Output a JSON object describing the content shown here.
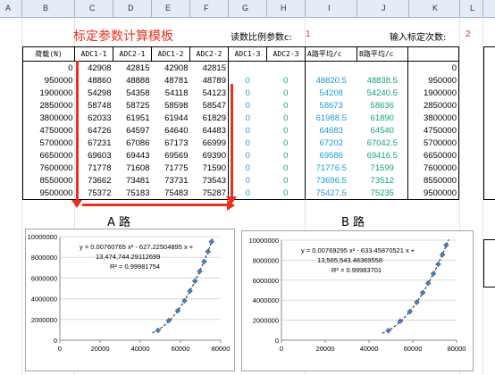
{
  "column_headers": [
    "A",
    "B",
    "C",
    "D",
    "E",
    "F",
    "G",
    "H",
    "I",
    "J",
    "K",
    "L"
  ],
  "title": "标定参数计算模板",
  "read_ratio_label": "读数比例参数c:",
  "read_ratio_value": "1",
  "input_count_label": "输入标定次数:",
  "input_count_value": "2",
  "table": {
    "headers": [
      "荷载(N)",
      "ADC1-1",
      "ADC2-1",
      "ADC1-2",
      "ADC2-2",
      "ADC1-3",
      "ADC2-3",
      "A路平均/c",
      "B路平均/c",
      ""
    ],
    "rows": [
      [
        "0",
        "42908",
        "42815",
        "42908",
        "42815",
        "",
        "",
        "",
        "",
        "0"
      ],
      [
        "950000",
        "48860",
        "48888",
        "48781",
        "48789",
        "0",
        "0",
        "48820.5",
        "48838.5",
        "950000"
      ],
      [
        "1900000",
        "54298",
        "54358",
        "54118",
        "54123",
        "0",
        "0",
        "54208",
        "54240.5",
        "1900000"
      ],
      [
        "2850000",
        "58748",
        "58725",
        "58598",
        "58547",
        "0",
        "0",
        "58673",
        "58636",
        "2850000"
      ],
      [
        "3800000",
        "62033",
        "61951",
        "61944",
        "61829",
        "0",
        "0",
        "61988.5",
        "61890",
        "3800000"
      ],
      [
        "4750000",
        "64726",
        "64597",
        "64640",
        "64483",
        "0",
        "0",
        "64683",
        "64540",
        "4750000"
      ],
      [
        "5700000",
        "67231",
        "67086",
        "67173",
        "66999",
        "0",
        "0",
        "67202",
        "67042.5",
        "5700000"
      ],
      [
        "6650000",
        "69603",
        "69443",
        "69569",
        "69390",
        "0",
        "0",
        "69586",
        "69416.5",
        "6650000"
      ],
      [
        "7600000",
        "71778",
        "71608",
        "71775",
        "71590",
        "0",
        "0",
        "71776.5",
        "71599",
        "7600000"
      ],
      [
        "8550000",
        "73662",
        "73481",
        "73731",
        "73543",
        "0",
        "0",
        "73696.5",
        "73512",
        "8550000"
      ],
      [
        "9500000",
        "75372",
        "75183",
        "75483",
        "75287",
        "0",
        "0",
        "75427.5",
        "75235",
        "9500000"
      ]
    ]
  },
  "chart_a_title": "A  路",
  "chart_b_title": "B  路",
  "chart_data": [
    {
      "type": "scatter",
      "y_ticks": [
        "10000000",
        "8000000",
        "6000000",
        "4000000",
        "2000000",
        "0"
      ],
      "x_ticks": [
        "0",
        "20000",
        "40000",
        "60000",
        "80000"
      ],
      "xlim": [
        0,
        80000
      ],
      "ylim": [
        0,
        10000000
      ],
      "x": [
        48820.5,
        54208,
        58673,
        61988.5,
        64683,
        67202,
        69586,
        71776.5,
        73696.5,
        75427.5
      ],
      "y": [
        950000,
        1900000,
        2850000,
        3800000,
        4750000,
        5700000,
        6650000,
        7600000,
        8550000,
        9500000
      ],
      "trendline": {
        "a": 0.00760765,
        "b": -627.22504895,
        "c": 13474744.29112699
      },
      "equation_line1": "y = 0.00760765 x² - 627.22504895 x +",
      "equation_line2": "13,474,744.29112699",
      "r2": "R² = 0.99981754"
    },
    {
      "type": "scatter",
      "y_ticks": [
        "10000000",
        "8000000",
        "6000000",
        "4000000",
        "2000000",
        "0"
      ],
      "x_ticks": [
        "0",
        "20000",
        "40000",
        "60000",
        "80000"
      ],
      "xlim": [
        0,
        80000
      ],
      "ylim": [
        0,
        10000000
      ],
      "x": [
        48838.5,
        54240.5,
        58636,
        61890,
        64540,
        67042.5,
        69416.5,
        71599,
        73512,
        75235
      ],
      "y": [
        950000,
        1900000,
        2850000,
        3800000,
        4750000,
        5700000,
        6650000,
        7600000,
        8550000,
        9500000
      ],
      "trendline": {
        "a": 0.00769295,
        "b": -633.45870521,
        "c": 13565543.48369558
      },
      "equation_line1": "y = 0.00769295 x² - 633.45870521 x +",
      "equation_line2": "13,565,543.48369558",
      "r2": "R² = 0.99983701"
    }
  ]
}
